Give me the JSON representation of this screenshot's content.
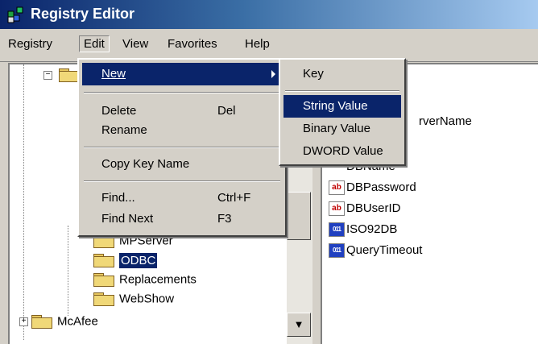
{
  "window": {
    "title": "Registry Editor"
  },
  "menubar": {
    "items": [
      "Registry",
      "Edit",
      "View",
      "Favorites",
      "Help"
    ]
  },
  "edit_menu": {
    "new": "New",
    "delete": "Delete",
    "delete_shortcut": "Del",
    "rename": "Rename",
    "copy_key_name": "Copy Key Name",
    "find": "Find...",
    "find_shortcut": "Ctrl+F",
    "find_next": "Find Next",
    "find_next_shortcut": "F3"
  },
  "new_submenu": {
    "key": "Key",
    "string_value": "String Value",
    "binary_value": "Binary Value",
    "dword_value": "DWORD Value"
  },
  "tree": {
    "items": [
      "MPServer",
      "ODBC",
      "Replacements",
      "WebShow",
      "McAfee"
    ],
    "selected": "ODBC"
  },
  "values": {
    "partial_top": "rverName",
    "partial_dbname": "DBName",
    "items": [
      {
        "name": "DBPassword",
        "icon": "string-value-icon"
      },
      {
        "name": "DBUserID",
        "icon": "string-value-icon"
      },
      {
        "name": "ISO92DB",
        "icon": "binary-value-icon"
      },
      {
        "name": "QueryTimeout",
        "icon": "binary-value-icon"
      }
    ]
  },
  "colors": {
    "highlight": "#0a246a",
    "chrome": "#d4d0c8",
    "title_start": "#0a246a",
    "title_end": "#a6caf0"
  }
}
